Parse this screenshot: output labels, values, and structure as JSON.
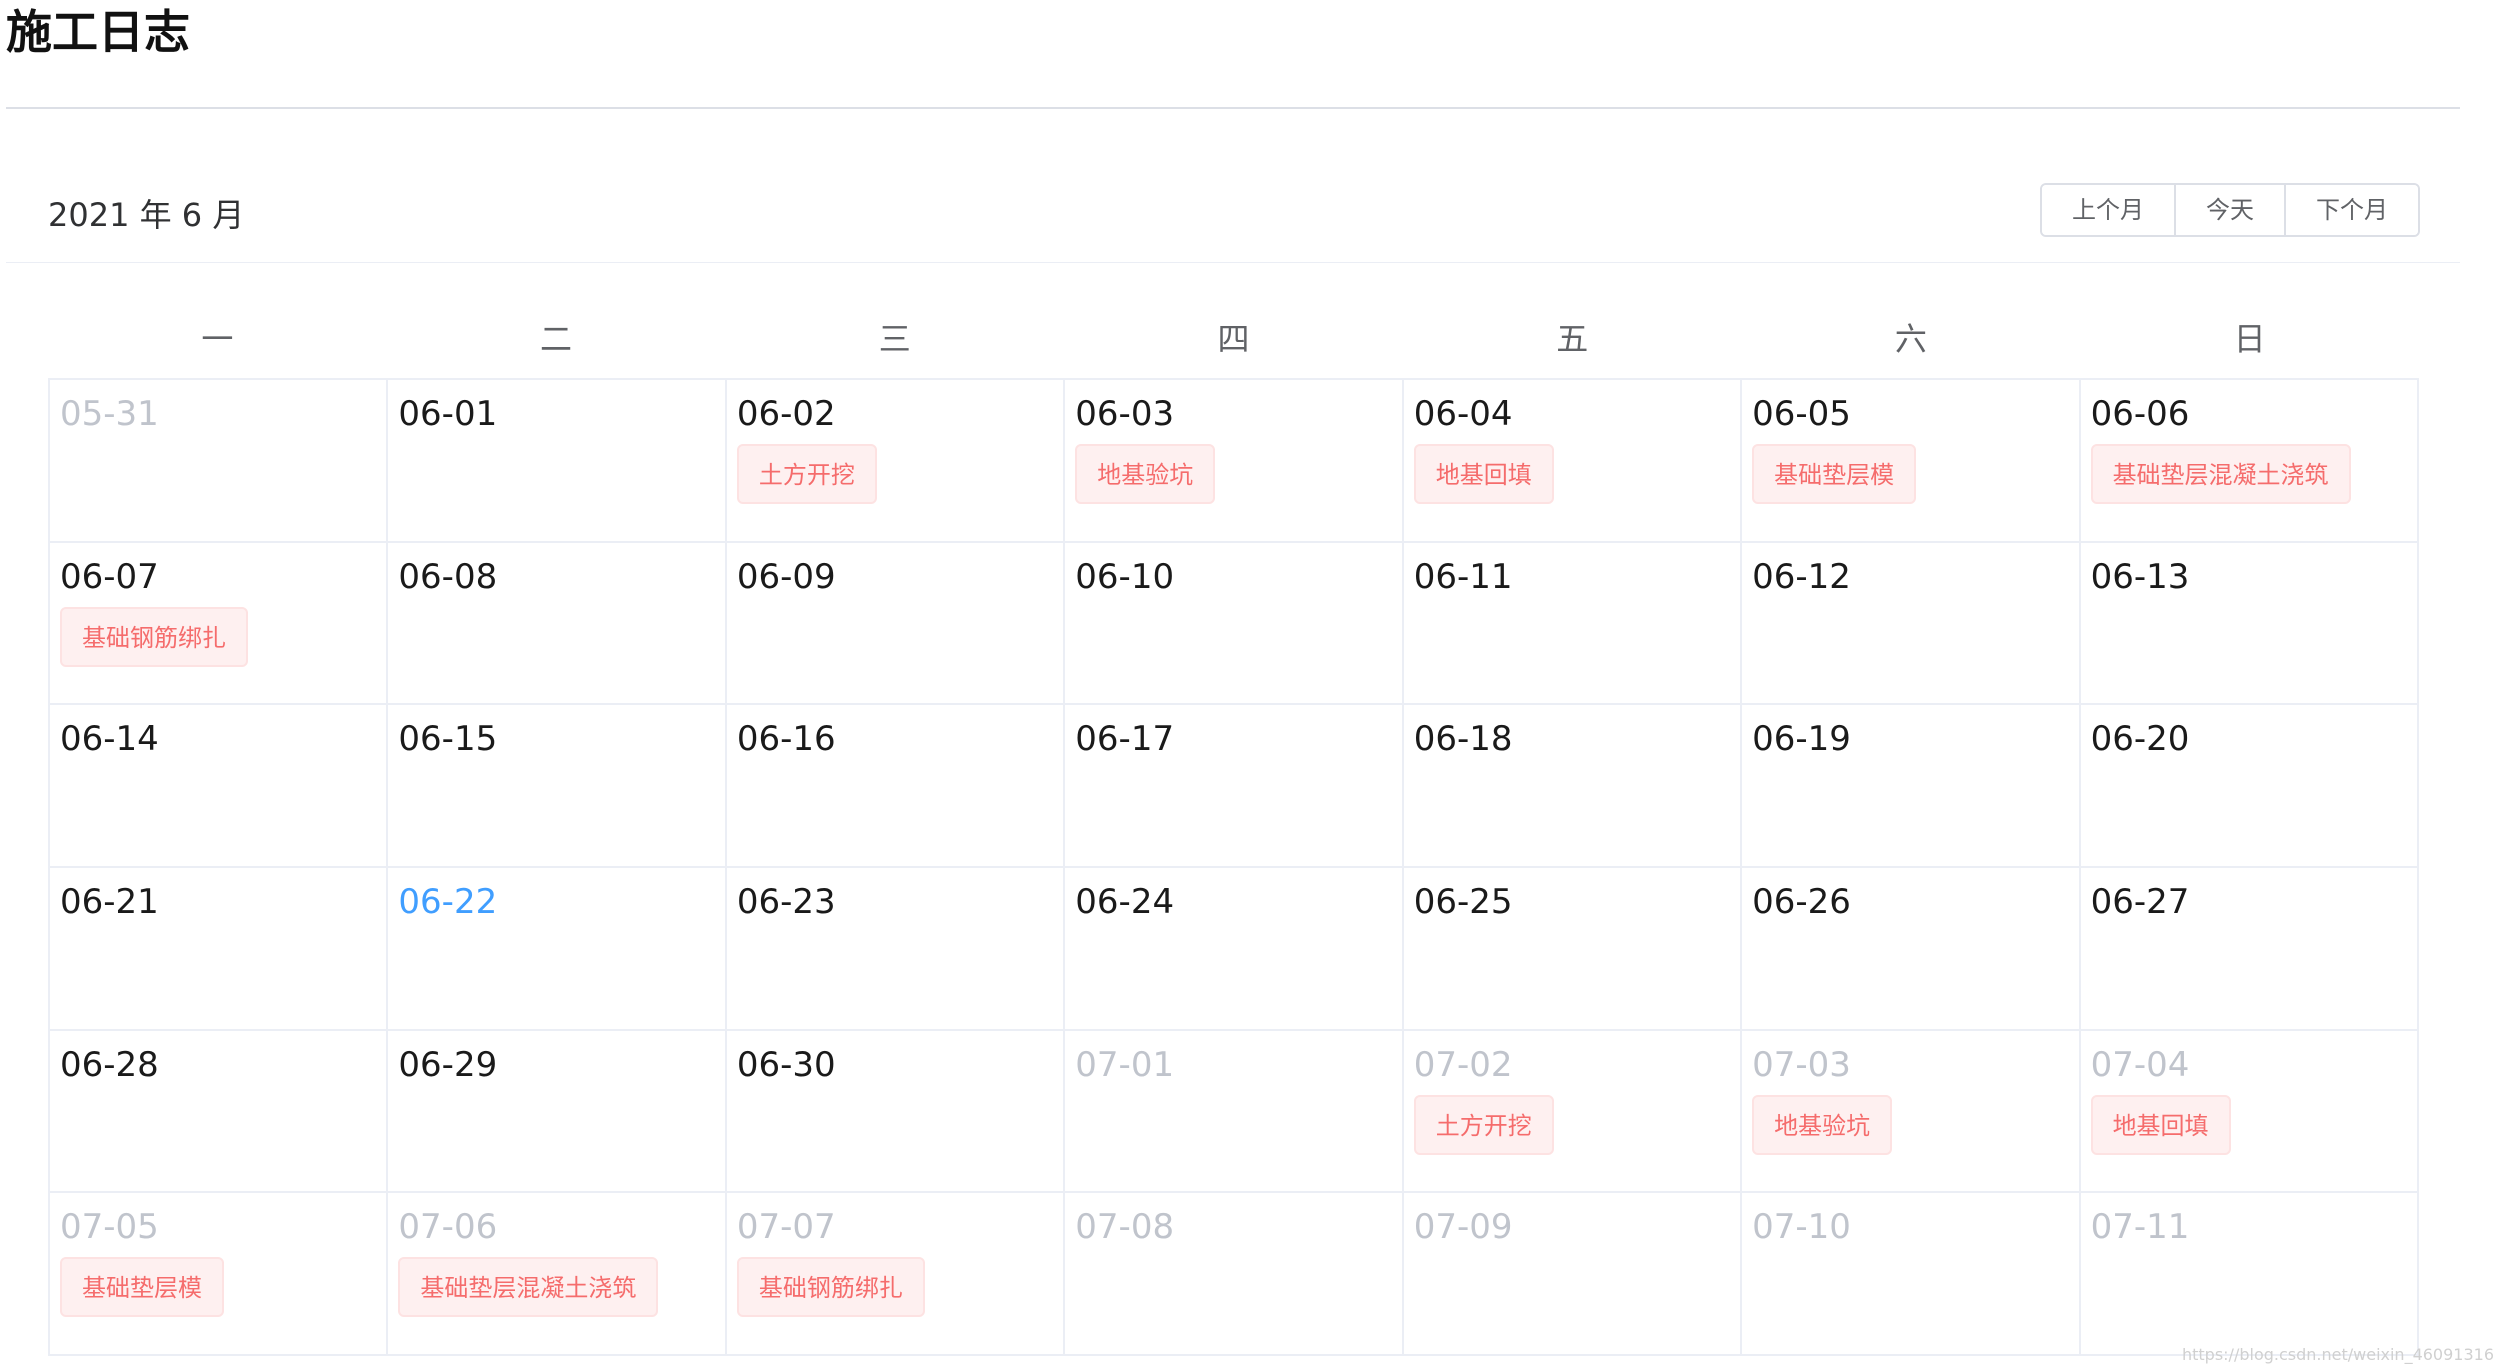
{
  "page": {
    "title": "施工日志"
  },
  "calendar": {
    "month_label": "2021 年 6 月",
    "buttons": {
      "prev": "上个月",
      "today": "今天",
      "next": "下个月"
    },
    "weekdays": [
      "一",
      "二",
      "三",
      "四",
      "五",
      "六",
      "日"
    ],
    "days": [
      {
        "date": "05-31",
        "state": "other",
        "tag": ""
      },
      {
        "date": "06-01",
        "state": "current",
        "tag": ""
      },
      {
        "date": "06-02",
        "state": "current",
        "tag": "土方开挖"
      },
      {
        "date": "06-03",
        "state": "current",
        "tag": "地基验坑"
      },
      {
        "date": "06-04",
        "state": "current",
        "tag": "地基回填"
      },
      {
        "date": "06-05",
        "state": "current",
        "tag": "基础垫层模"
      },
      {
        "date": "06-06",
        "state": "current",
        "tag": "基础垫层混凝土浇筑"
      },
      {
        "date": "06-07",
        "state": "current",
        "tag": "基础钢筋绑扎"
      },
      {
        "date": "06-08",
        "state": "current",
        "tag": ""
      },
      {
        "date": "06-09",
        "state": "current",
        "tag": ""
      },
      {
        "date": "06-10",
        "state": "current",
        "tag": ""
      },
      {
        "date": "06-11",
        "state": "current",
        "tag": ""
      },
      {
        "date": "06-12",
        "state": "current",
        "tag": ""
      },
      {
        "date": "06-13",
        "state": "current",
        "tag": ""
      },
      {
        "date": "06-14",
        "state": "current",
        "tag": ""
      },
      {
        "date": "06-15",
        "state": "current",
        "tag": ""
      },
      {
        "date": "06-16",
        "state": "current",
        "tag": ""
      },
      {
        "date": "06-17",
        "state": "current",
        "tag": ""
      },
      {
        "date": "06-18",
        "state": "current",
        "tag": ""
      },
      {
        "date": "06-19",
        "state": "current",
        "tag": ""
      },
      {
        "date": "06-20",
        "state": "current",
        "tag": ""
      },
      {
        "date": "06-21",
        "state": "current",
        "tag": ""
      },
      {
        "date": "06-22",
        "state": "today",
        "tag": ""
      },
      {
        "date": "06-23",
        "state": "current",
        "tag": ""
      },
      {
        "date": "06-24",
        "state": "current",
        "tag": ""
      },
      {
        "date": "06-25",
        "state": "current",
        "tag": ""
      },
      {
        "date": "06-26",
        "state": "current",
        "tag": ""
      },
      {
        "date": "06-27",
        "state": "current",
        "tag": ""
      },
      {
        "date": "06-28",
        "state": "current",
        "tag": ""
      },
      {
        "date": "06-29",
        "state": "current",
        "tag": ""
      },
      {
        "date": "06-30",
        "state": "current",
        "tag": ""
      },
      {
        "date": "07-01",
        "state": "other",
        "tag": ""
      },
      {
        "date": "07-02",
        "state": "other",
        "tag": "土方开挖"
      },
      {
        "date": "07-03",
        "state": "other",
        "tag": "地基验坑"
      },
      {
        "date": "07-04",
        "state": "other",
        "tag": "地基回填"
      },
      {
        "date": "07-05",
        "state": "other",
        "tag": "基础垫层模"
      },
      {
        "date": "07-06",
        "state": "other",
        "tag": "基础垫层混凝土浇筑"
      },
      {
        "date": "07-07",
        "state": "other",
        "tag": "基础钢筋绑扎"
      },
      {
        "date": "07-08",
        "state": "other",
        "tag": ""
      },
      {
        "date": "07-09",
        "state": "other",
        "tag": ""
      },
      {
        "date": "07-10",
        "state": "other",
        "tag": ""
      },
      {
        "date": "07-11",
        "state": "other",
        "tag": ""
      }
    ]
  },
  "watermark": "https://blog.csdn.net/weixin_46091316",
  "colors": {
    "tag_text": "#f56c6c",
    "tag_bg": "#fef0f0",
    "tag_border": "#fde2e2",
    "today": "#409eff",
    "other_month": "#c0c4cc",
    "border": "#ebeef5"
  }
}
